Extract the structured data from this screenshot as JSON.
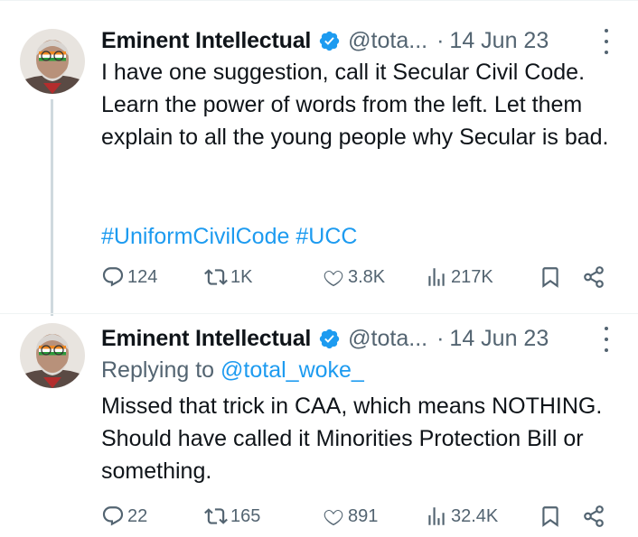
{
  "tweets": [
    {
      "author_name": "Eminent Intellectual",
      "handle": "@tota...",
      "separator": "·",
      "date": "14 Jun 23",
      "body": "I have one suggestion, call it Secular Civil Code. Learn the power of words from the left. Let them explain to all the young people why Secular is bad.",
      "hashtags": [
        "#UniformCivilCode",
        "#UCC"
      ],
      "stats": {
        "replies": "124",
        "reposts": "1K",
        "likes": "3.8K",
        "views": "217K"
      }
    },
    {
      "author_name": "Eminent Intellectual",
      "handle": "@tota...",
      "separator": "·",
      "date": "14 Jun 23",
      "replying_prefix": "Replying to ",
      "replying_to": "@total_woke_",
      "body": "Missed that trick in CAA, which means NOTHING. Should have called it Minorities Protection Bill or something.",
      "stats": {
        "replies": "22",
        "reposts": "165",
        "likes": "891",
        "views": "32.4K"
      }
    }
  ],
  "colors": {
    "accent": "#1d9bf0",
    "text": "#0f1419",
    "secondary": "#536471",
    "thread_line": "#cfd9de"
  },
  "icons": [
    "verified-badge-icon",
    "more-options-icon",
    "reply-icon",
    "repost-icon",
    "like-icon",
    "views-icon",
    "bookmark-icon",
    "share-icon"
  ]
}
